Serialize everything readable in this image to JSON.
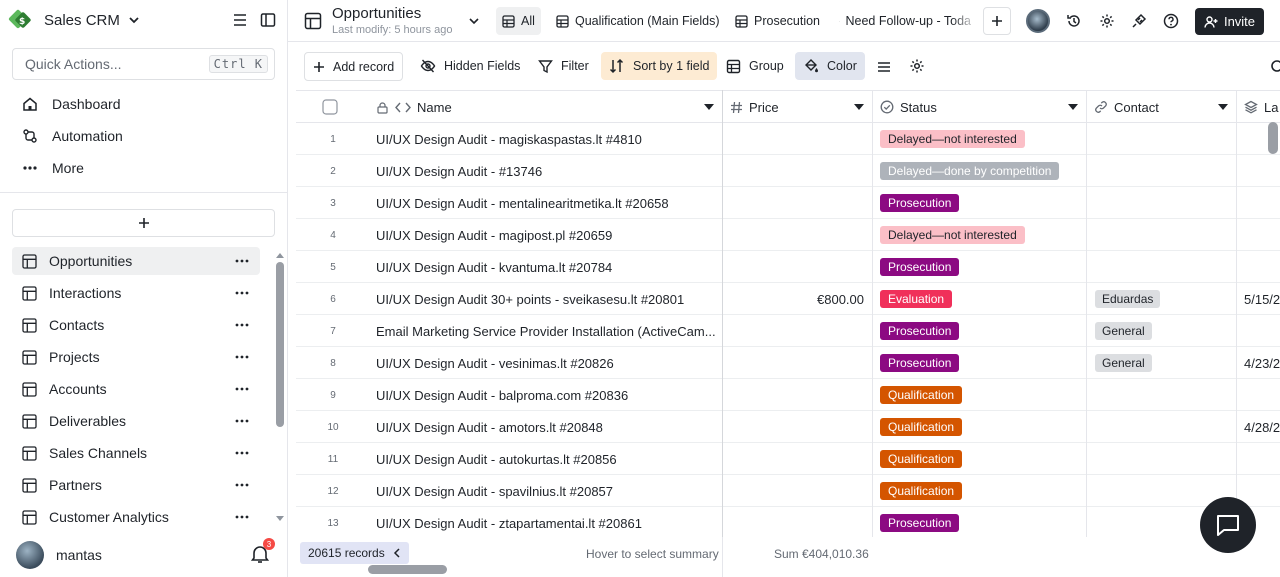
{
  "workspace": {
    "name": "Sales CRM"
  },
  "quick_actions": {
    "placeholder": "Quick Actions...",
    "shortcut": "Ctrl K"
  },
  "nav": [
    {
      "label": "Dashboard",
      "icon": "home-icon"
    },
    {
      "label": "Automation",
      "icon": "automation-icon"
    },
    {
      "label": "More",
      "icon": "more-dots-icon"
    }
  ],
  "tables": [
    {
      "label": "Opportunities",
      "active": true
    },
    {
      "label": "Interactions"
    },
    {
      "label": "Contacts"
    },
    {
      "label": "Projects"
    },
    {
      "label": "Accounts"
    },
    {
      "label": "Deliverables"
    },
    {
      "label": "Sales Channels"
    },
    {
      "label": "Partners"
    },
    {
      "label": "Customer Analytics"
    }
  ],
  "user": {
    "name": "mantas",
    "notifications": "3"
  },
  "header": {
    "title": "Opportunities",
    "subtitle": "Last modify: 5 hours ago",
    "views": [
      "All",
      "Qualification (Main Fields)",
      "Prosecution",
      "Need Follow-up - Toda"
    ],
    "invite_label": "Invite"
  },
  "toolbar": {
    "add_record": "Add record",
    "hidden_fields": "Hidden Fields",
    "filter": "Filter",
    "sort": "Sort by 1 field",
    "group": "Group",
    "color": "Color"
  },
  "columns": {
    "name": "Name",
    "price": "Price",
    "status": "Status",
    "contact": "Contact",
    "last": "La"
  },
  "rows": [
    {
      "n": "1",
      "name": "UI/UX Design Audit - magiskaspastas.lt #4810",
      "price": "",
      "status": "Delayed—not interested",
      "status_kind": "delayed",
      "contact": "",
      "date": ""
    },
    {
      "n": "2",
      "name": "UI/UX Design Audit -  #13746",
      "price": "",
      "status": "Delayed—done by competition",
      "status_kind": "competition",
      "contact": "",
      "date": ""
    },
    {
      "n": "3",
      "name": "UI/UX Design Audit - mentalinearitmetika.lt #20658",
      "price": "",
      "status": "Prosecution",
      "status_kind": "prosecution",
      "contact": "",
      "date": ""
    },
    {
      "n": "4",
      "name": "UI/UX Design Audit - magipost.pl #20659",
      "price": "",
      "status": "Delayed—not interested",
      "status_kind": "delayed",
      "contact": "",
      "date": ""
    },
    {
      "n": "5",
      "name": "UI/UX Design Audit - kvantuma.lt #20784",
      "price": "",
      "status": "Prosecution",
      "status_kind": "prosecution",
      "contact": "",
      "date": ""
    },
    {
      "n": "6",
      "name": "UI/UX Design Audit 30+ points - sveikasesu.lt #20801",
      "price": "€800.00",
      "status": "Evaluation",
      "status_kind": "evaluation",
      "contact": "Eduardas",
      "date": "5/15/2"
    },
    {
      "n": "7",
      "name": "Email Marketing Service Provider Installation (ActiveCam...",
      "price": "",
      "status": "Prosecution",
      "status_kind": "prosecution",
      "contact": "General",
      "date": ""
    },
    {
      "n": "8",
      "name": "UI/UX Design Audit - vesinimas.lt #20826",
      "price": "",
      "status": "Prosecution",
      "status_kind": "prosecution",
      "contact": "General",
      "date": "4/23/2"
    },
    {
      "n": "9",
      "name": "UI/UX Design Audit - balproma.com #20836",
      "price": "",
      "status": "Qualification",
      "status_kind": "qualification",
      "contact": "",
      "date": ""
    },
    {
      "n": "10",
      "name": "UI/UX Design Audit - amotors.lt #20848",
      "price": "",
      "status": "Qualification",
      "status_kind": "qualification",
      "contact": "",
      "date": "4/28/2"
    },
    {
      "n": "11",
      "name": "UI/UX Design Audit - autokurtas.lt #20856",
      "price": "",
      "status": "Qualification",
      "status_kind": "qualification",
      "contact": "",
      "date": ""
    },
    {
      "n": "12",
      "name": "UI/UX Design Audit - spavilnius.lt #20857",
      "price": "",
      "status": "Qualification",
      "status_kind": "qualification",
      "contact": "",
      "date": ""
    },
    {
      "n": "13",
      "name": "UI/UX Design Audit - ztapartamentai.lt #20861",
      "price": "",
      "status": "Prosecution",
      "status_kind": "prosecution",
      "contact": "",
      "date": ""
    }
  ],
  "status_colors": {
    "delayed": {
      "bg": "#fbbfc7",
      "fg": "#1f2329"
    },
    "competition": {
      "bg": "#aeb3ba",
      "fg": "#ffffff"
    },
    "prosecution": {
      "bg": "#8c0a82",
      "fg": "#ffffff"
    },
    "evaluation": {
      "bg": "#f0305a",
      "fg": "#ffffff"
    },
    "qualification": {
      "bg": "#d45500",
      "fg": "#ffffff"
    }
  },
  "footer": {
    "records": "20615 records",
    "hover": "Hover to select summary",
    "sum": "Sum €404,010.36"
  }
}
